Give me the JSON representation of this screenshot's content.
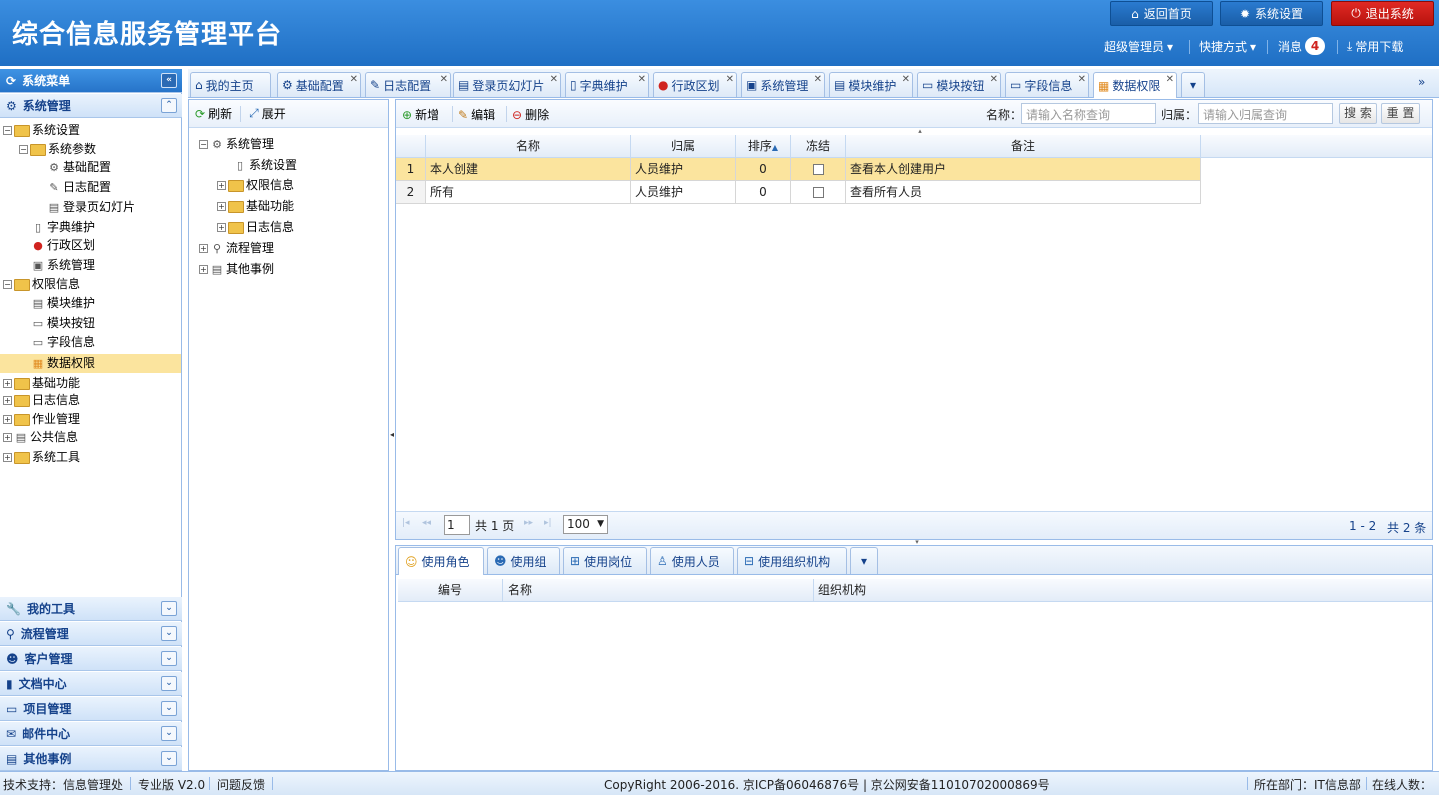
{
  "app": {
    "title": "综合信息服务管理平台"
  },
  "top": {
    "home": "返回首页",
    "settings": "系统设置",
    "logout": "退出系统",
    "user": "超级管理员",
    "shortcuts": "快捷方式",
    "messages": "消息",
    "msg_count": "4",
    "downloads": "常用下载"
  },
  "sidebar": {
    "title": "系统菜单",
    "section": "系统管理",
    "tree": [
      {
        "label": "系统设置"
      },
      {
        "label": "系统参数"
      },
      {
        "label": "基础配置"
      },
      {
        "label": "日志配置"
      },
      {
        "label": "登录页幻灯片"
      },
      {
        "label": "字典维护"
      },
      {
        "label": "行政区划"
      },
      {
        "label": "系统管理"
      },
      {
        "label": "权限信息"
      },
      {
        "label": "模块维护"
      },
      {
        "label": "模块按钮"
      },
      {
        "label": "字段信息"
      },
      {
        "label": "数据权限"
      },
      {
        "label": "基础功能"
      },
      {
        "label": "日志信息"
      },
      {
        "label": "作业管理"
      },
      {
        "label": "公共信息"
      },
      {
        "label": "系统工具"
      }
    ],
    "groups": [
      {
        "label": "我的工具"
      },
      {
        "label": "流程管理"
      },
      {
        "label": "客户管理"
      },
      {
        "label": "文档中心"
      },
      {
        "label": "项目管理"
      },
      {
        "label": "邮件中心"
      },
      {
        "label": "其他事例"
      }
    ]
  },
  "tabs": [
    {
      "label": "我的主页"
    },
    {
      "label": "基础配置"
    },
    {
      "label": "日志配置"
    },
    {
      "label": "登录页幻灯片"
    },
    {
      "label": "字典维护"
    },
    {
      "label": "行政区划"
    },
    {
      "label": "系统管理"
    },
    {
      "label": "模块维护"
    },
    {
      "label": "模块按钮"
    },
    {
      "label": "字段信息"
    },
    {
      "label": "数据权限"
    }
  ],
  "midtree": {
    "refresh": "刷新",
    "expand": "展开",
    "nodes": [
      {
        "label": "系统管理"
      },
      {
        "label": "系统设置"
      },
      {
        "label": "权限信息"
      },
      {
        "label": "基础功能"
      },
      {
        "label": "日志信息"
      },
      {
        "label": "流程管理"
      },
      {
        "label": "其他事例"
      }
    ]
  },
  "grid": {
    "add": "新增",
    "edit": "编辑",
    "delete": "删除",
    "name_label": "名称：",
    "name_placeholder": "请输入名称查询",
    "owner_label": "归属：",
    "owner_placeholder": "请输入归属查询",
    "search": "搜 索",
    "reset": "重 置",
    "columns": [
      "名称",
      "归属",
      "排序",
      "冻结",
      "备注"
    ],
    "rows": [
      {
        "num": "1",
        "name": "本人创建",
        "owner": "人员维护",
        "order": "0",
        "note": "查看本人创建用户"
      },
      {
        "num": "2",
        "name": "所有",
        "owner": "人员维护",
        "order": "0",
        "note": "查看所有人员"
      }
    ],
    "pager": {
      "page": "1",
      "total_pages": "共 1 页",
      "size": "100",
      "range": "1 - 2",
      "total": "共 2 条"
    }
  },
  "bottom": {
    "tabs": [
      "使用角色",
      "使用组",
      "使用岗位",
      "使用人员",
      "使用组织机构"
    ],
    "columns": [
      "编号",
      "名称",
      "组织机构"
    ]
  },
  "footer": {
    "support": "技术支持：信息管理处",
    "edition": "专业版 V2.0",
    "feedback": "问题反馈",
    "copyright": "CopyRight 2006-2016. 京ICP备06046876号 | 京公网安备11010702000869号",
    "dept": "所在部门：IT信息部",
    "online": "在线人数："
  },
  "colors": {
    "header": "#2a7fd6",
    "selected": "#fbe49e",
    "logout": "#d0231f"
  }
}
